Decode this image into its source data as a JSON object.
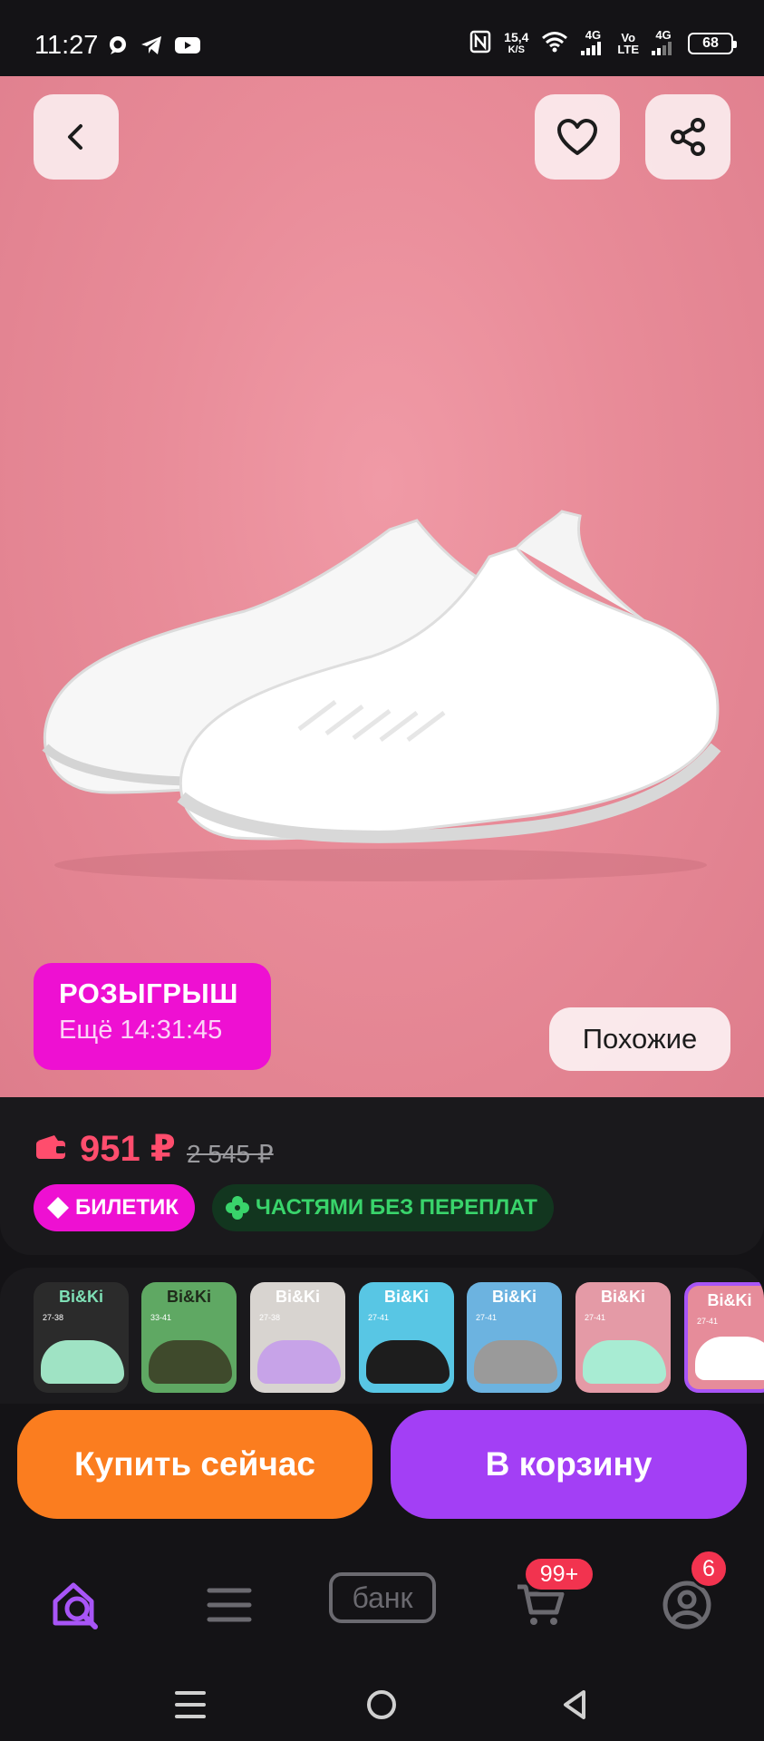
{
  "status_bar": {
    "time": "11:27",
    "app_icons": [
      "chat-bubble-icon",
      "telegram-icon",
      "youtube-icon"
    ],
    "nfc": "N",
    "speed_value": "15,4",
    "speed_unit": "K/S",
    "net1": "4G",
    "volte_top": "Vo",
    "volte_bottom": "LTE",
    "net2": "4G",
    "battery": "68"
  },
  "hero": {
    "background_color": "#e88b98",
    "promo_title": "РОЗЫГРЫШ",
    "promo_timer": "Ещё 14:31:45",
    "similar_label": "Похожие"
  },
  "price": {
    "current": "951 ₽",
    "old": "2 545 ₽",
    "current_color": "#ff4d6d"
  },
  "badges": {
    "ticket": "БИЛЕТИК",
    "installments": "ЧАСТЯМИ БЕЗ ПЕРЕПЛАТ"
  },
  "thumbnails": [
    {
      "brand": "Bi&Ki",
      "size": "27-38",
      "bg": "#2b2b2b",
      "shoe": "#9fe3c4"
    },
    {
      "brand": "Bi&Ki",
      "size": "33-41",
      "bg": "#5fa863",
      "shoe": "#3f4a2c"
    },
    {
      "brand": "Bi&Ki",
      "size": "27-38",
      "bg": "#d8d4d0",
      "shoe": "#c7a3e8"
    },
    {
      "brand": "Bi&Ki",
      "size": "27-41",
      "bg": "#58c6e4",
      "shoe": "#1d1d1d"
    },
    {
      "brand": "Bi&Ki",
      "size": "27-41",
      "bg": "#6cb3e0",
      "shoe": "#9a9a9a"
    },
    {
      "brand": "Bi&Ki",
      "size": "27-41",
      "bg": "#e49aa6",
      "shoe": "#a8ecd3"
    },
    {
      "brand": "Bi&Ki",
      "size": "27-41",
      "bg": "#e68c9a",
      "shoe": "#ffffff"
    }
  ],
  "actions": {
    "buy_now": "Купить сейчас",
    "add_to_cart": "В корзину"
  },
  "bottom_nav": {
    "bank_label": "банк",
    "cart_count": "99+",
    "profile_count": "6",
    "active_color": "#a855f7"
  }
}
